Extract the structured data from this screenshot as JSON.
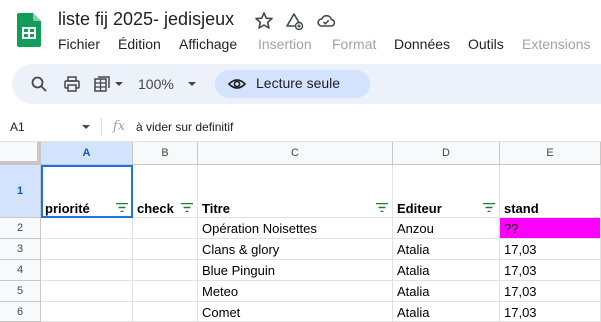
{
  "document": {
    "title": "liste fij 2025- jedisjeux"
  },
  "menu": [
    "Fichier",
    "Édition",
    "Affichage",
    "Insertion",
    "Format",
    "Données",
    "Outils",
    "Extensions"
  ],
  "toolbar": {
    "zoom": "100%",
    "readonly_label": "Lecture seule"
  },
  "formula_bar": {
    "cell_ref": "A1",
    "fx": "fx",
    "content": "à vider sur definitif"
  },
  "columns": [
    "A",
    "B",
    "C",
    "D",
    "E"
  ],
  "rows": [
    "1",
    "2",
    "3",
    "4",
    "5",
    "6"
  ],
  "headers": [
    "priorité",
    "check",
    "Titre",
    "Editeur",
    "stand"
  ],
  "data": [
    [
      "",
      "",
      "Opération Noisettes",
      "Anzou",
      "??"
    ],
    [
      "",
      "",
      "Clans & glory",
      "Atalia",
      "17,03"
    ],
    [
      "",
      "",
      "Blue Pinguin",
      "Atalia",
      "17,03"
    ],
    [
      "",
      "",
      "Meteo",
      "Atalia",
      "17,03"
    ],
    [
      "",
      "",
      "Comet",
      "Atalia",
      "17,03"
    ]
  ],
  "colors": {
    "highlight_cell": "#ff00ff",
    "selection": "#1a73e8",
    "logo_green": "#0f9d58"
  },
  "icons": [
    "sheets-logo-icon",
    "star-icon",
    "move-to-folder-icon",
    "cloud-saved-icon",
    "search-icon",
    "print-icon",
    "format-icon",
    "eye-icon",
    "filter-icon"
  ]
}
